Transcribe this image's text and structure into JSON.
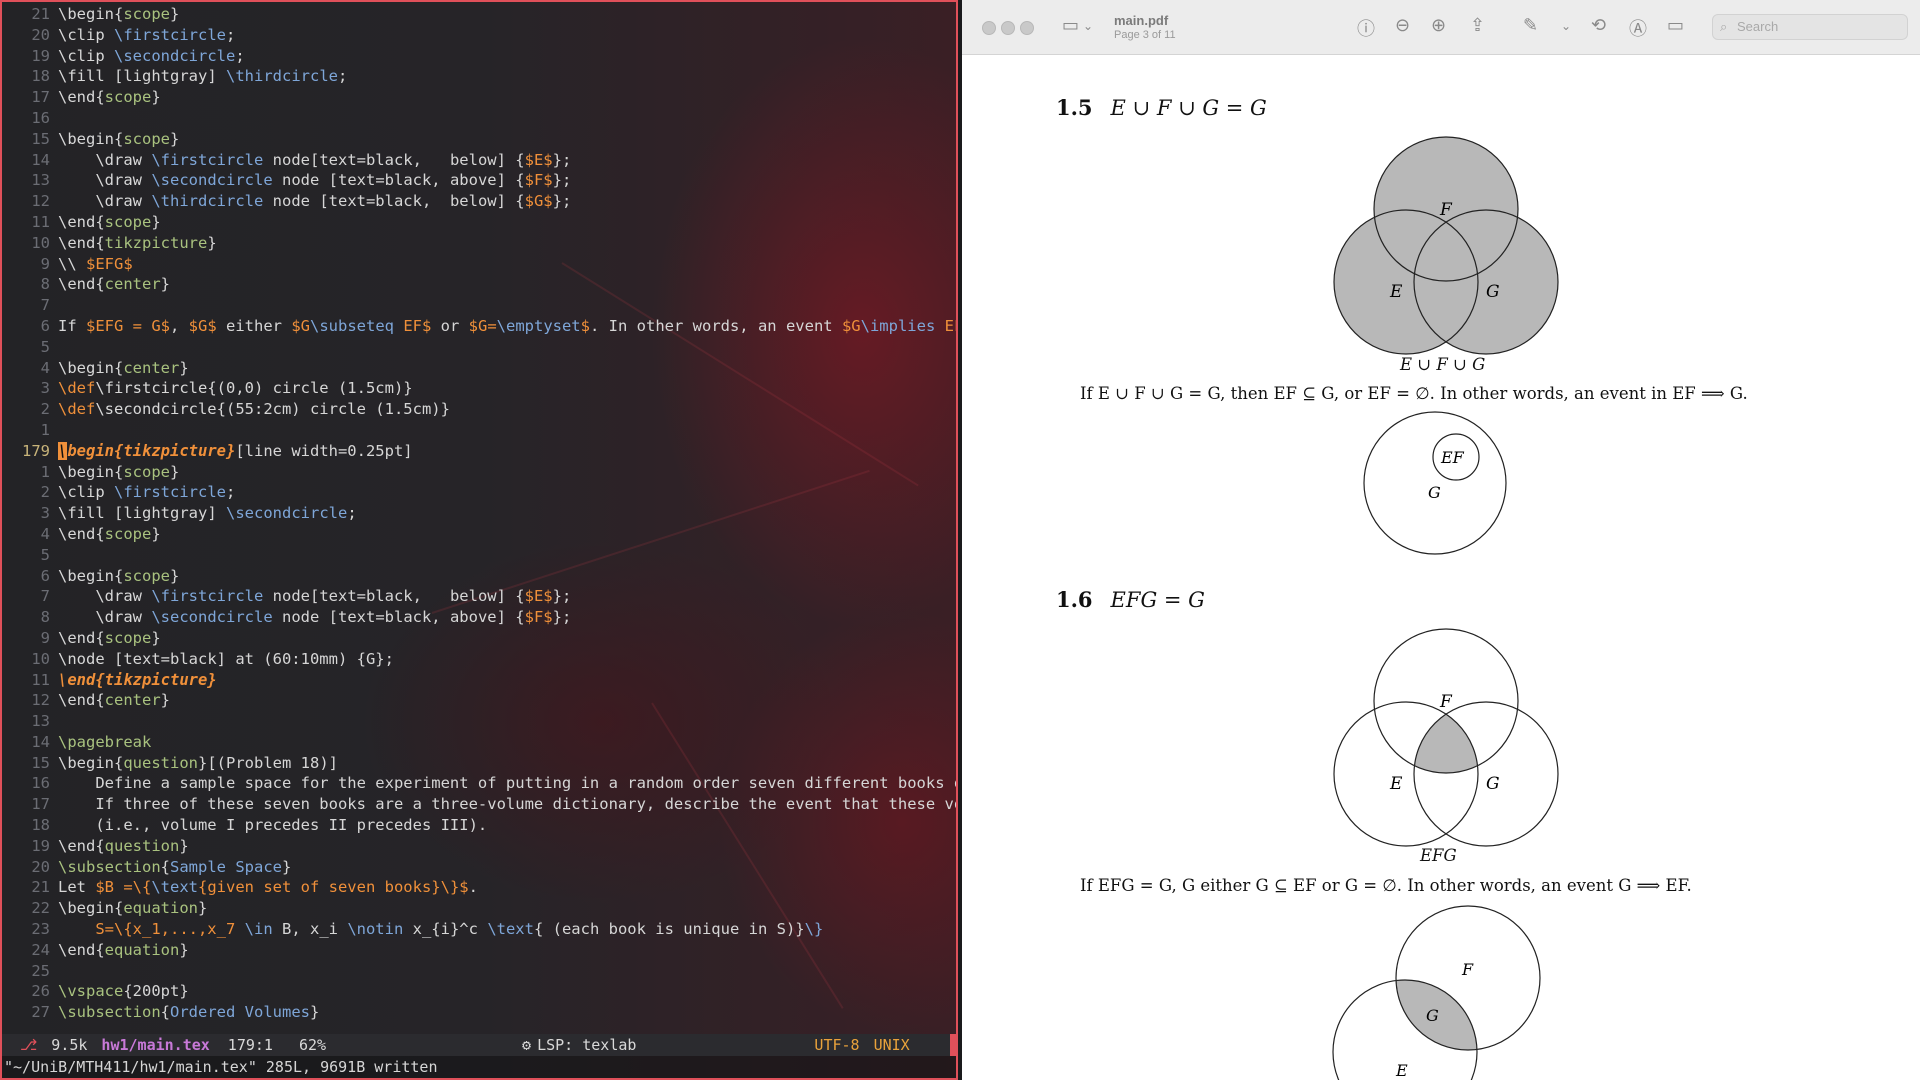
{
  "editor": {
    "lines": [
      {
        "n": "21",
        "html": "<span class='bw'>\\begin</span>{<span class='arg'>scope</span>}"
      },
      {
        "n": "20",
        "html": "<span class='bw'>\\clip</span> <span class='sym'>\\firstcircle</span>;"
      },
      {
        "n": "19",
        "html": "<span class='bw'>\\clip</span> <span class='sym'>\\secondcircle</span>;"
      },
      {
        "n": "18",
        "html": "<span class='bw'>\\fill</span> [lightgray] <span class='sym'>\\thirdcircle</span>;"
      },
      {
        "n": "17",
        "html": "<span class='bw'>\\end</span>{<span class='arg'>scope</span>}"
      },
      {
        "n": "16",
        "html": ""
      },
      {
        "n": "15",
        "html": "<span class='bw'>\\begin</span>{<span class='arg'>scope</span>}"
      },
      {
        "n": "14",
        "html": "    <span class='bw'>\\draw</span> <span class='sym'>\\firstcircle</span> node[text=black,   below] {<span class='math'>$E$</span>};"
      },
      {
        "n": "13",
        "html": "    <span class='bw'>\\draw</span> <span class='sym'>\\secondcircle</span> node [text=black, above] {<span class='math'>$F$</span>};"
      },
      {
        "n": "12",
        "html": "    <span class='bw'>\\draw</span> <span class='sym'>\\thirdcircle</span> node [text=black,  below] {<span class='math'>$G$</span>};"
      },
      {
        "n": "11",
        "html": "<span class='bw'>\\end</span>{<span class='arg'>scope</span>}"
      },
      {
        "n": "10",
        "html": "<span class='bw'>\\end</span>{<span class='arg'>tikzpicture</span>}"
      },
      {
        "n": "9",
        "html": "\\\\ <span class='math'>$EFG$</span>"
      },
      {
        "n": "8",
        "html": "<span class='bw'>\\end</span>{<span class='arg'>center</span>}"
      },
      {
        "n": "7",
        "html": ""
      },
      {
        "n": "6",
        "html": "If <span class='math'>$EFG = G$</span>, <span class='math'>$G$</span> either <span class='math'>$G</span><span class='sym'>\\subseteq</span><span class='math'> EF$</span> or <span class='math'>$G=</span><span class='sym'>\\emptyset</span><span class='math'>$</span>. In other words, an event <span class='math'>$G</span><span class='sym'>\\implies</span><span class='math'> EF$</span>."
      },
      {
        "n": "5",
        "html": ""
      },
      {
        "n": "4",
        "html": "<span class='bw'>\\begin</span>{<span class='arg'>center</span>}"
      },
      {
        "n": "3",
        "html": "<span class='math'>\\def</span><span class='bw'>\\firstcircle</span>{(0,0) circle (1.5cm)}"
      },
      {
        "n": "2",
        "html": "<span class='math'>\\def</span><span class='bw'>\\secondcircle</span>{(55:2cm) circle (1.5cm)}"
      },
      {
        "n": "1",
        "html": ""
      },
      {
        "n": "179",
        "cur": true,
        "html": "<span class='kw'><span class='cursor'>\\</span>begin{tikzpicture}</span>[line width=0.25pt]"
      },
      {
        "n": "1",
        "html": "<span class='bw'>\\begin</span>{<span class='arg'>scope</span>}"
      },
      {
        "n": "2",
        "html": "<span class='bw'>\\clip</span> <span class='sym'>\\firstcircle</span>;"
      },
      {
        "n": "3",
        "html": "<span class='bw'>\\fill</span> [lightgray] <span class='sym'>\\secondcircle</span>;"
      },
      {
        "n": "4",
        "html": "<span class='bw'>\\end</span>{<span class='arg'>scope</span>}"
      },
      {
        "n": "5",
        "html": ""
      },
      {
        "n": "6",
        "html": "<span class='bw'>\\begin</span>{<span class='arg'>scope</span>}"
      },
      {
        "n": "7",
        "html": "    <span class='bw'>\\draw</span> <span class='sym'>\\firstcircle</span> node[text=black,   below] {<span class='math'>$E$</span>};"
      },
      {
        "n": "8",
        "html": "    <span class='bw'>\\draw</span> <span class='sym'>\\secondcircle</span> node [text=black, above] {<span class='math'>$F$</span>};"
      },
      {
        "n": "9",
        "html": "<span class='bw'>\\end</span>{<span class='arg'>scope</span>}"
      },
      {
        "n": "10",
        "html": "<span class='bw'>\\node</span> [text=black] at (60:10mm) {G};"
      },
      {
        "n": "11",
        "html": "<span class='kw'>\\end{tikzpicture}</span>"
      },
      {
        "n": "12",
        "html": "<span class='bw'>\\end</span>{<span class='arg'>center</span>}"
      },
      {
        "n": "13",
        "html": ""
      },
      {
        "n": "14",
        "html": "<span class='arg'>\\pagebreak</span>"
      },
      {
        "n": "15",
        "html": "<span class='bw'>\\begin</span>{<span class='arg'>question</span>}[(Problem 18)]"
      },
      {
        "n": "16",
        "html": "    Define a sample space for the experiment of putting in a random order seven different books on a"
      },
      {
        "n": "17",
        "html": "    If three of these seven books are a three-volume dictionary, describe the event that these volum"
      },
      {
        "n": "18",
        "html": "    (i.e., volume I precedes II precedes III)."
      },
      {
        "n": "19",
        "html": "<span class='bw'>\\end</span>{<span class='arg'>question</span>}"
      },
      {
        "n": "20",
        "html": "<span class='arg'>\\subsection</span>{<span class='sym'>Sample Space</span>}"
      },
      {
        "n": "21",
        "html": "Let <span class='math'>$B =\\{</span><span class='sym'>\\text</span><span class='math'>{given set of seven books}\\}$</span>."
      },
      {
        "n": "22",
        "html": "<span class='bw'>\\begin</span>{<span class='arg'>equation</span>}"
      },
      {
        "n": "23",
        "html": "    <span class='math'>S=\\{x_1,...,x_7</span> <span class='sym'>\\in</span> B, x_i <span class='sym'>\\notin</span> x_{i}^c <span class='sym'>\\text</span>{ (each book is unique in S)}<span class='sym'>\\}</span>"
      },
      {
        "n": "24",
        "html": "<span class='bw'>\\end</span>{<span class='arg'>equation</span>}"
      },
      {
        "n": "25",
        "html": ""
      },
      {
        "n": "26",
        "html": "<span class='arg'>\\vspace</span>{200pt}"
      },
      {
        "n": "27",
        "html": "<span class='arg'>\\subsection</span>{<span class='sym'>Ordered Volumes</span>}"
      }
    ],
    "status": {
      "icon": "git-branch-icon",
      "size": "9.5k",
      "file": "hw1/main.tex",
      "position": "179:1",
      "percent": "62%",
      "lsp": "LSP: texlab",
      "encoding": "UTF-8",
      "format": "UNIX"
    },
    "cmdline": "\"~/UniB/MTH411/hw1/main.tex\" 285L, 9691B written"
  },
  "viewer": {
    "title": "main.pdf",
    "subtitle": "Page 3 of 11",
    "search_placeholder": "Search"
  },
  "pdf": {
    "sec15": {
      "num": "1.5",
      "expr": "E ∪ F ∪ G = G"
    },
    "venn1_caption": "E ∪ F ∪ G",
    "para1": "If E ∪ F ∪ G = G, then EF ⊆ G, or EF = ∅. In other words, an event in EF  ⟹  G.",
    "sec16": {
      "num": "1.6",
      "expr": "EFG = G"
    },
    "venn3_caption": "EFG",
    "para2": "If EFG = G, G either G ⊆ EF or G = ∅. In other words, an event G  ⟹  EF.",
    "labels": {
      "E": "E",
      "F": "F",
      "G": "G",
      "EF": "EF"
    }
  }
}
